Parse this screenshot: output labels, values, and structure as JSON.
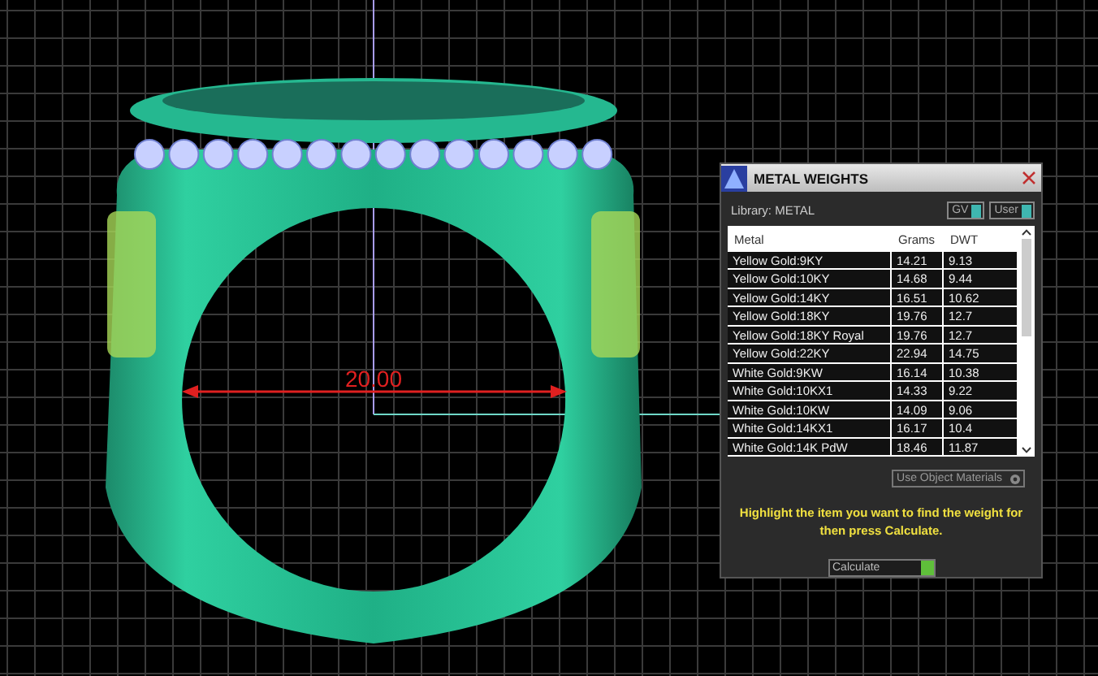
{
  "viewport": {
    "dimension": "20.00"
  },
  "panel": {
    "title": "METAL WEIGHTS",
    "library": "Library: METAL",
    "toggles": [
      "GV",
      "User"
    ],
    "table": {
      "columns": [
        "Metal",
        "Grams",
        "DWT"
      ],
      "rows": [
        [
          "Yellow Gold:9KY",
          "14.21",
          "9.13"
        ],
        [
          "Yellow Gold:10KY",
          "14.68",
          "9.44"
        ],
        [
          "Yellow Gold:14KY",
          "16.51",
          "10.62"
        ],
        [
          "Yellow Gold:18KY",
          "19.76",
          "12.7"
        ],
        [
          "Yellow Gold:18KY Royal",
          "19.76",
          "12.7"
        ],
        [
          "Yellow Gold:22KY",
          "22.94",
          "14.75"
        ],
        [
          "White Gold:9KW",
          "16.14",
          "10.38"
        ],
        [
          "White Gold:10KX1",
          "14.33",
          "9.22"
        ],
        [
          "White Gold:10KW",
          "14.09",
          "9.06"
        ],
        [
          "White Gold:14KX1",
          "16.17",
          "10.4"
        ],
        [
          "White Gold:14K PdW",
          "18.46",
          "11.87"
        ]
      ]
    },
    "materials_button": "Use Object Materials",
    "hint": "Highlight the item you want to find the weight for then press Calculate.",
    "calculate": "Calculate"
  }
}
